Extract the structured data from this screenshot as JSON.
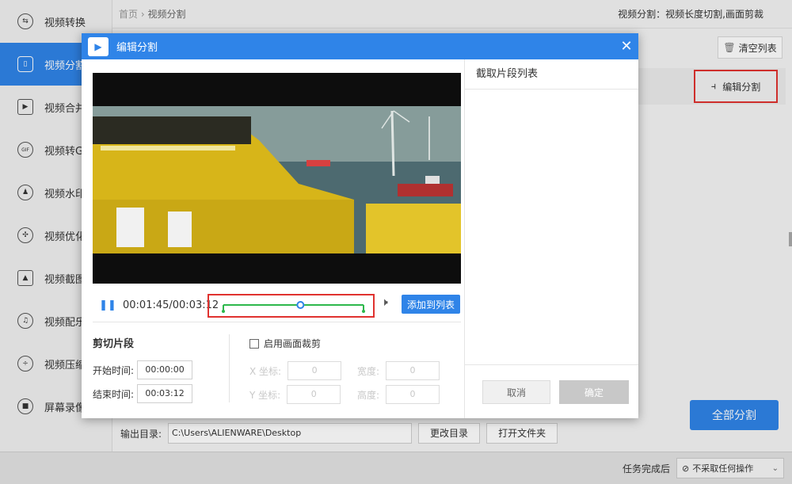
{
  "sidebar": {
    "items": [
      {
        "label": "视频转换",
        "icon": "swap-icon"
      },
      {
        "label": "视频分割",
        "icon": "split-icon",
        "active": true
      },
      {
        "label": "视频合并",
        "icon": "merge-icon"
      },
      {
        "label": "视频转GIF",
        "icon": "gif-icon"
      },
      {
        "label": "视频水印",
        "icon": "watermark-icon"
      },
      {
        "label": "视频优化",
        "icon": "optimize-icon"
      },
      {
        "label": "视频截图",
        "icon": "screenshot-icon"
      },
      {
        "label": "视频配乐",
        "icon": "music-icon"
      },
      {
        "label": "视频压缩",
        "icon": "compress-icon"
      },
      {
        "label": "屏幕录像",
        "icon": "record-icon"
      }
    ]
  },
  "header": {
    "breadcrumb_home": "首页",
    "breadcrumb_sep": "›",
    "breadcrumb_current": "视频分割",
    "hint": "视频分割：视频长度切割,画面剪裁"
  },
  "main": {
    "clear_label": "清空列表",
    "edit_split_label": "编辑分割",
    "output_label": "输出目录:",
    "output_path": "C:\\Users\\ALIENWARE\\Desktop",
    "change_dir_label": "更改目录",
    "open_folder_label": "打开文件夹",
    "split_all_label": "全部分割"
  },
  "footer": {
    "task_done_label": "任务完成后",
    "task_option": "不采取任何操作"
  },
  "modal": {
    "title": "编辑分割",
    "player": {
      "time_display": "00:01:45/00:03:12",
      "playhead_fraction": 0.55,
      "range_start_fraction": 0.0,
      "range_end_fraction": 1.0
    },
    "add_to_list_label": "添加到列表",
    "cut": {
      "title": "剪切片段",
      "start_label": "开始时间:",
      "start_value": "00:00:00",
      "end_label": "结束时间:",
      "end_value": "00:03:12"
    },
    "crop": {
      "enable_label": "启用画面裁剪",
      "x_label": "X 坐标:",
      "x_value": "0",
      "y_label": "Y 坐标:",
      "y_value": "0",
      "width_label": "宽度:",
      "width_value": "0",
      "height_label": "高度:",
      "height_value": "0"
    },
    "list_title": "截取片段列表",
    "cancel_label": "取消",
    "confirm_label": "确定"
  },
  "colors": {
    "accent": "#2f84e8",
    "highlight": "#e0322f",
    "slider": "#2db84c"
  }
}
